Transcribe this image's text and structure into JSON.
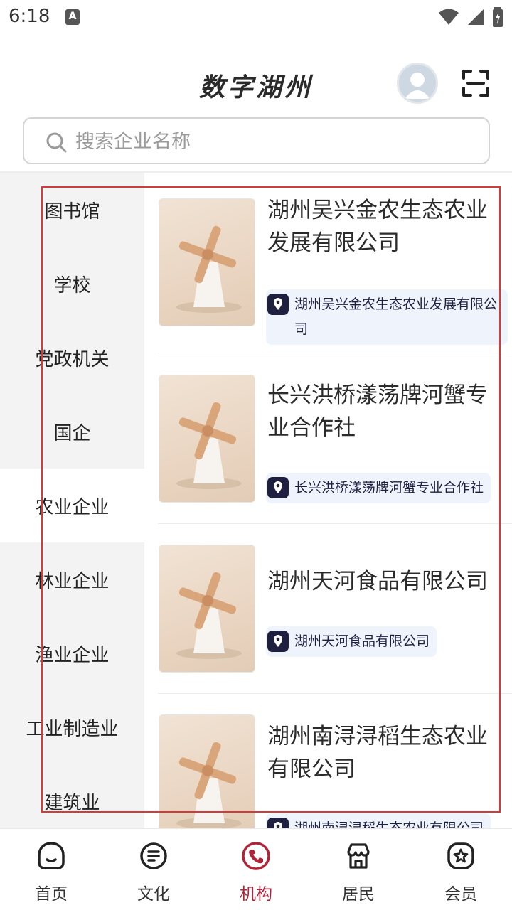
{
  "status_bar": {
    "time": "6:18",
    "notification_glyph": "A"
  },
  "header": {
    "title": "数字湖州"
  },
  "search": {
    "placeholder": "搜索企业名称",
    "value": ""
  },
  "sidebar": {
    "items": [
      {
        "label": "图书馆",
        "active": false
      },
      {
        "label": "学校",
        "active": false
      },
      {
        "label": "党政机关",
        "active": false
      },
      {
        "label": "国企",
        "active": false
      },
      {
        "label": "农业企业",
        "active": true
      },
      {
        "label": "林业企业",
        "active": false
      },
      {
        "label": "渔业企业",
        "active": false
      },
      {
        "label": "工业制造业",
        "active": false
      },
      {
        "label": "建筑业",
        "active": false
      }
    ]
  },
  "list": {
    "items": [
      {
        "title": "湖州吴兴金农生态农业发展有限公司",
        "tag": "湖州吴兴金农生态农业发展有限公司",
        "thumb_icon": "windmill-image"
      },
      {
        "title": "长兴洪桥漾荡牌河蟹专业合作社",
        "tag": "长兴洪桥漾荡牌河蟹专业合作社",
        "thumb_icon": "windmill-image"
      },
      {
        "title": "湖州天河食品有限公司",
        "tag": "湖州天河食品有限公司",
        "thumb_icon": "windmill-image"
      },
      {
        "title": "湖州南浔浔稻生态农业有限公司",
        "tag": "湖州南浔浔稻生态农业有限公司",
        "thumb_icon": "windmill-image"
      }
    ]
  },
  "bottom_nav": {
    "items": [
      {
        "label": "首页",
        "icon": "home-face-icon",
        "active": false
      },
      {
        "label": "文化",
        "icon": "document-icon",
        "active": false
      },
      {
        "label": "机构",
        "icon": "phone-icon",
        "active": true
      },
      {
        "label": "居民",
        "icon": "shop-icon",
        "active": false
      },
      {
        "label": "会员",
        "icon": "star-badge-icon",
        "active": false
      }
    ]
  },
  "colors": {
    "accent": "#b0243a",
    "highlight_box": "#d43a3a",
    "sidebar_bg": "#f3f3f3",
    "tag_bg": "#eef3fc"
  }
}
